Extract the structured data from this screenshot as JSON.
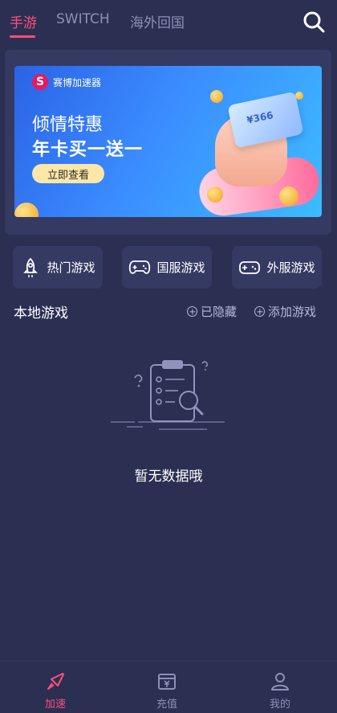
{
  "header": {
    "tabs": [
      {
        "label": "手游",
        "active": true
      },
      {
        "label": "SWITCH",
        "active": false
      },
      {
        "label": "海外回国",
        "active": false
      }
    ],
    "search_icon": "search-icon"
  },
  "banner": {
    "brand": "赛博加速器",
    "brand_logo_letter": "S",
    "headline": "倾情特惠",
    "subline": "年卡买一送一",
    "cta": "立即查看",
    "card_text": "¥366"
  },
  "categories": [
    {
      "label": "热门游戏",
      "icon": "rocket-icon"
    },
    {
      "label": "国服游戏",
      "icon": "gamepad-icon"
    },
    {
      "label": "外服游戏",
      "icon": "controller-icon"
    }
  ],
  "local_games": {
    "title": "本地游戏",
    "hidden_label": "已隐藏",
    "add_label": "添加游戏",
    "empty_text": "暂无数据哦"
  },
  "bottom_nav": [
    {
      "label": "加速",
      "icon": "accelerate-icon",
      "active": true
    },
    {
      "label": "充值",
      "icon": "recharge-icon",
      "active": false
    },
    {
      "label": "我的",
      "icon": "profile-icon",
      "active": false
    }
  ],
  "colors": {
    "background": "#2b2f52",
    "card": "#353a63",
    "accent": "#ff4f7b",
    "muted": "#8d90b5"
  }
}
